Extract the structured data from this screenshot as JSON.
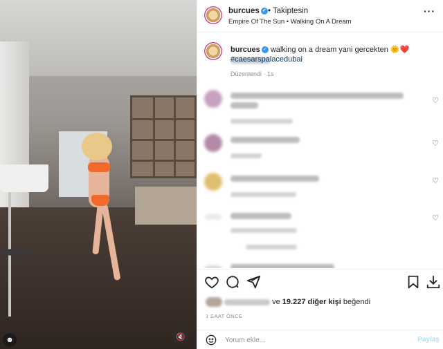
{
  "header": {
    "username": "burcues",
    "follow_status": "• Takiptesin",
    "song": "Empire Of The Sun • Walking On A Dream",
    "more_icon": "more-horizontal-icon"
  },
  "caption": {
    "username": "burcues",
    "text": "walking on a dream yani gercekten 🌞❤️",
    "hashtag": "#caesarspalacedubai",
    "edited": "Düzenlendi · 1s"
  },
  "comments": [
    {
      "avatar_color": "#c8a0c0",
      "hearted": true
    },
    {
      "avatar_color": "#b48aa8",
      "hearted": true
    },
    {
      "avatar_color": "#e0c070",
      "hearted": true
    },
    {
      "avatar_color": "#e8e8e8",
      "hearted": true
    },
    {
      "avatar_color": "#d8d8d8",
      "hearted": false
    }
  ],
  "actions": {
    "like_icon": "heart-icon",
    "comment_icon": "comment-icon",
    "share_icon": "send-icon",
    "save_icon": "bookmark-icon",
    "download_icon": "download-icon"
  },
  "likes": {
    "prefix": "ve",
    "count": "19.227 diğer kişi",
    "suffix": "beğendi"
  },
  "timestamp": "1 SAAT ÖNCE",
  "comment_box": {
    "placeholder": "Yorum ekle...",
    "post_label": "Paylaş"
  },
  "colors": {
    "verified": "#3897f0",
    "link": "#00376b",
    "post_disabled": "#b2dffc"
  }
}
